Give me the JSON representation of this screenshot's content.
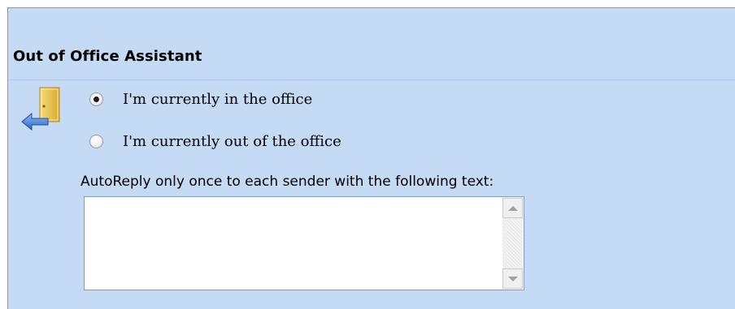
{
  "section": {
    "title": "Out of Office Assistant",
    "icon": "out-of-office-door-icon"
  },
  "options": [
    {
      "label": "I'm currently in the office",
      "checked": true
    },
    {
      "label": "I'm currently out of the office",
      "checked": false
    }
  ],
  "autoreply": {
    "label": "AutoReply only once to each sender with the following text:",
    "text": ""
  },
  "colors": {
    "panel_background": "#c4daf5",
    "border": "#7f9db9"
  }
}
